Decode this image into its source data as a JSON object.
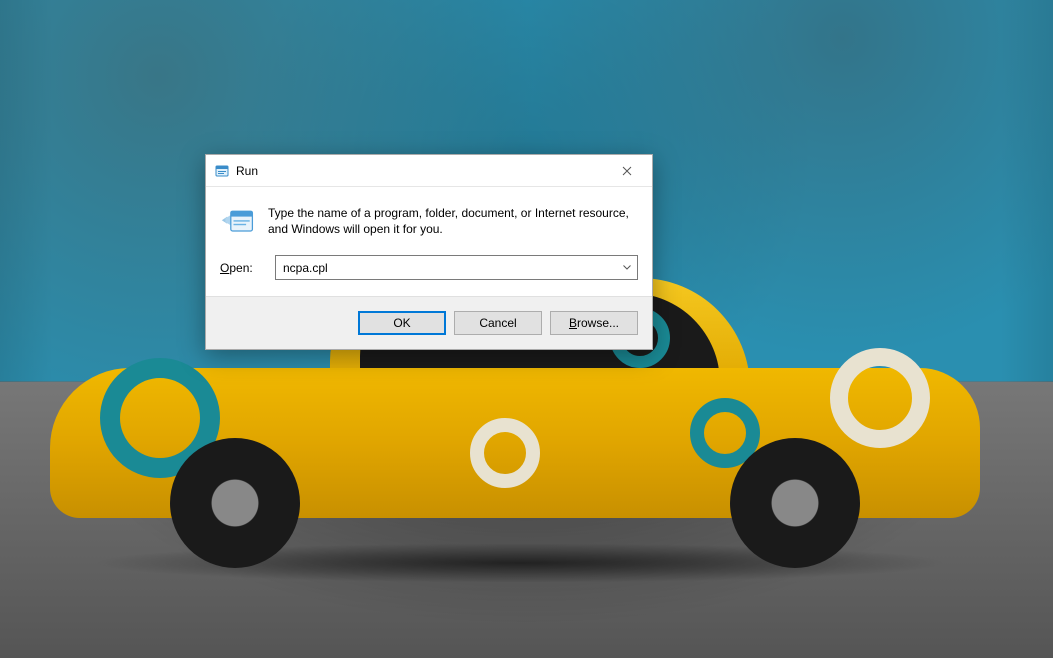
{
  "dialog": {
    "title": "Run",
    "info_text": "Type the name of a program, folder, document, or Internet resource, and Windows will open it for you.",
    "open_label_pre": "O",
    "open_label_post": "pen:",
    "open_value": "ncpa.cpl",
    "buttons": {
      "ok": "OK",
      "cancel": "Cancel",
      "browse_pre": "B",
      "browse_post": "rowse..."
    }
  }
}
